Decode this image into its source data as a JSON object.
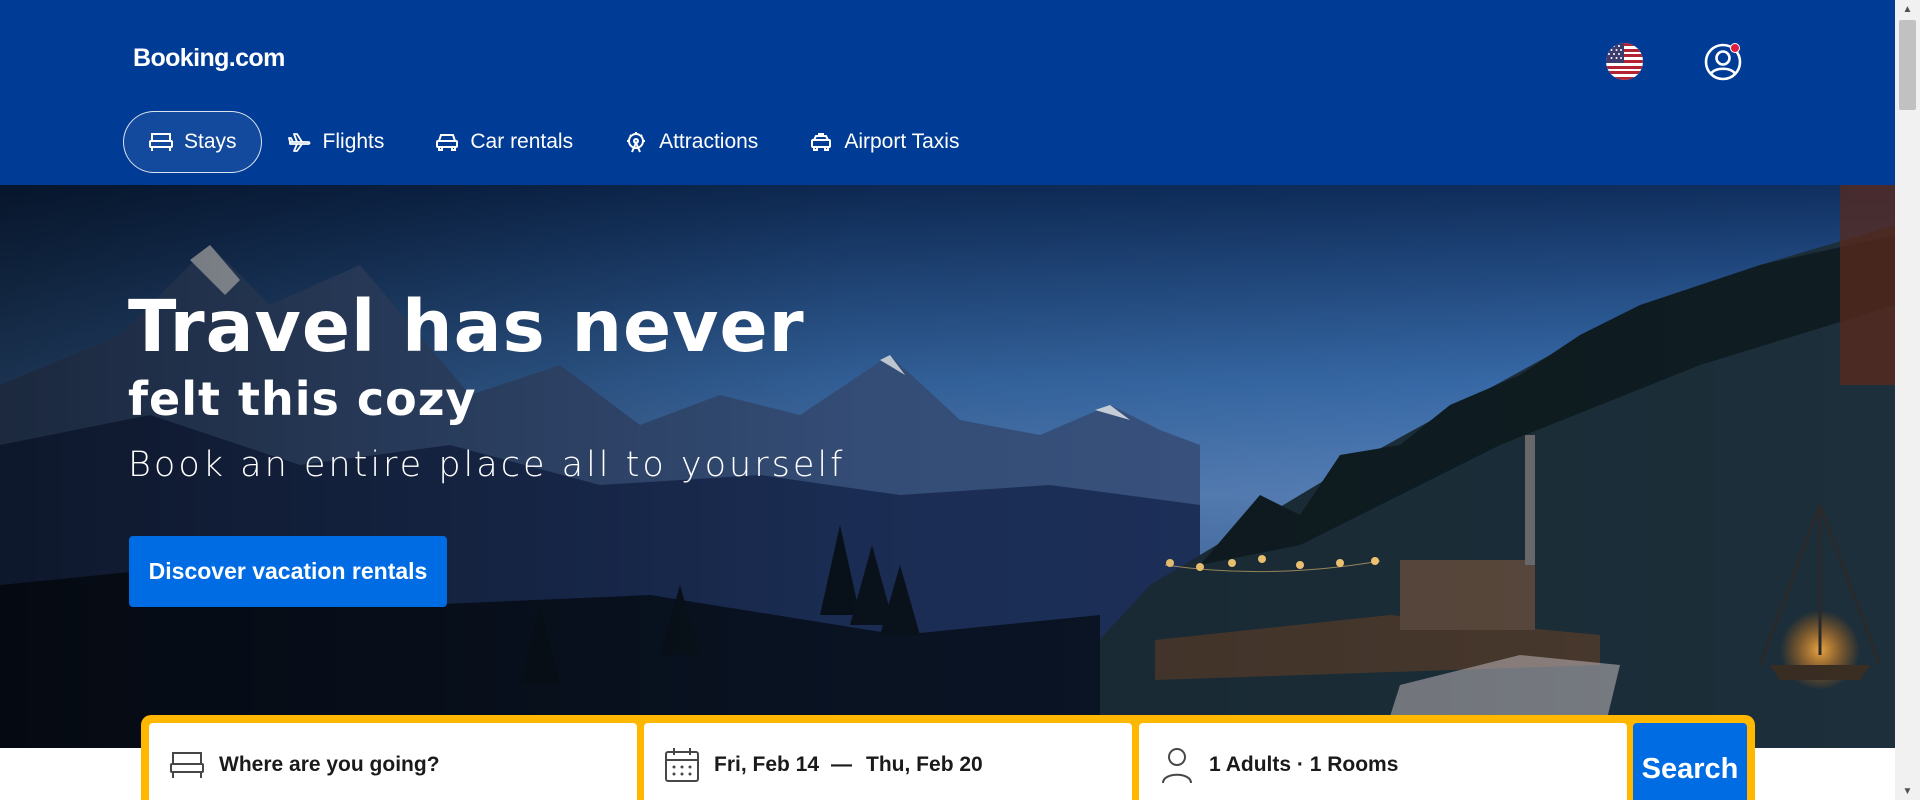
{
  "header": {
    "logo": "Booking.com",
    "flag_icon": "us-flag-icon",
    "account_icon": "user-account-icon"
  },
  "nav": {
    "items": [
      {
        "label": "Stays",
        "icon": "bed-icon",
        "active": true
      },
      {
        "label": "Flights",
        "icon": "plane-icon",
        "active": false
      },
      {
        "label": "Car rentals",
        "icon": "car-icon",
        "active": false
      },
      {
        "label": "Attractions",
        "icon": "ferris-wheel-icon",
        "active": false
      },
      {
        "label": "Airport Taxis",
        "icon": "taxi-icon",
        "active": false
      }
    ]
  },
  "hero": {
    "title": "Travel has never",
    "subtitle": "felt this cozy",
    "tagline": "Book an entire place all to yourself",
    "cta_label": "Discover vacation rentals"
  },
  "search": {
    "destination_placeholder": "Where are you going?",
    "checkin": "Fri, Feb 14",
    "date_separator": "—",
    "checkout": "Thu, Feb 20",
    "guests": "1 Adults · 1 Rooms",
    "button_label": "Search"
  },
  "colors": {
    "brand_blue": "#003b95",
    "accent_blue": "#006ce4",
    "search_border": "#ffb700",
    "notification": "#e21c3c"
  }
}
